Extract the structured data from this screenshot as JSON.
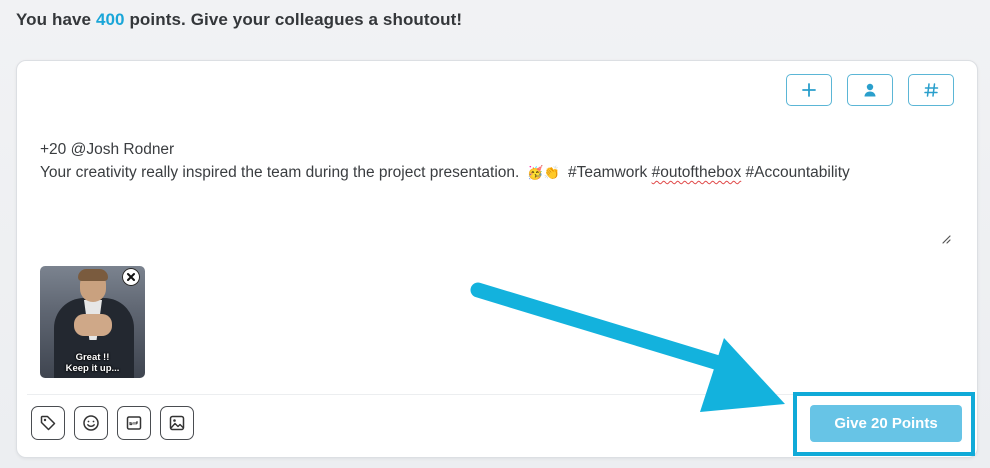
{
  "header": {
    "prefix": "You have",
    "points": "400",
    "suffix": "points. Give your colleagues a shoutout!"
  },
  "toolbar_top": {
    "add_icon": "plus-icon",
    "mention_icon": "person-icon",
    "hashtag_icon": "hashtag-icon",
    "add_glyph": "+",
    "hashtag_glyph": "#"
  },
  "message": {
    "line1": "+20 @Josh Rodner",
    "line2_text": "Your creativity really inspired the team during the project presentation.",
    "emojis": "🥳👏",
    "tag1": "#Teamwork",
    "tag2": "#outofthebox",
    "tag3": "#Accountability"
  },
  "attachment": {
    "caption_line1": "Great !!",
    "caption_line2": "Keep it up..."
  },
  "composer_tools": {
    "tag_icon": "tag-icon",
    "emoji_icon": "smiley-icon",
    "gif_icon": "gif-icon",
    "image_icon": "image-icon"
  },
  "submit": {
    "label": "Give 20 Points"
  },
  "colors": {
    "accent": "#1aa6d8",
    "button": "#67c4e6",
    "highlight": "#10aad8"
  }
}
